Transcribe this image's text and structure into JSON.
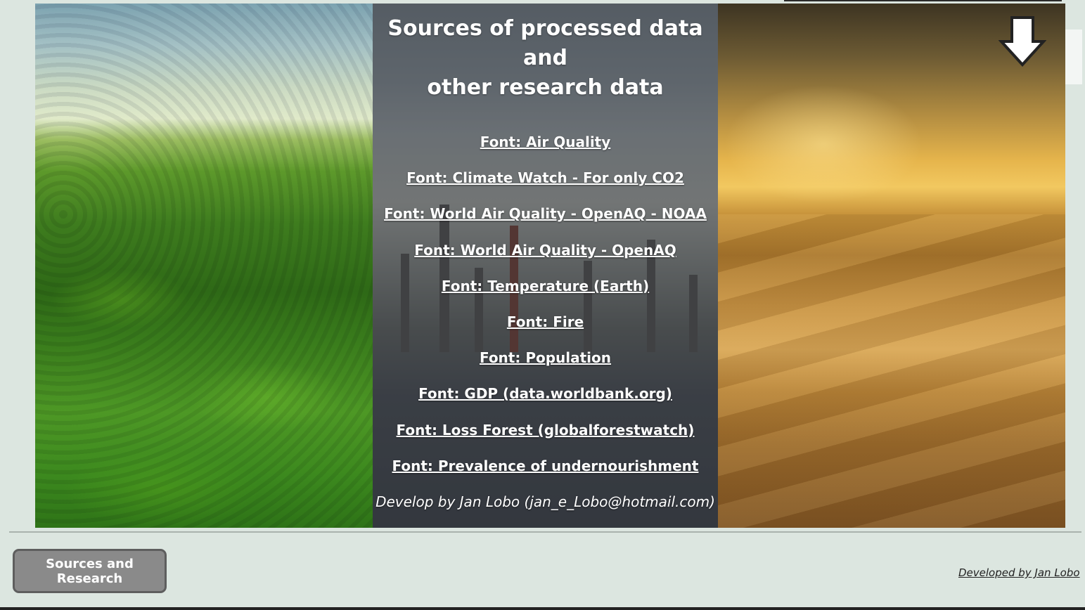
{
  "panel": {
    "title_line1": "Sources of processed data and",
    "title_line2": "other research data",
    "links": [
      "Font: Air Quality",
      "Font: Climate Watch - For only CO2",
      "Font: World Air Quality - OpenAQ - NOAA",
      "Font: World Air Quality - OpenAQ",
      "Font: Temperature (Earth)",
      "Font: Fire",
      "Font: Population",
      "Font: GDP (data.worldbank.org)",
      "Font: Loss Forest (globalforestwatch)",
      "Font: Prevalence of undernourishment"
    ],
    "credit": "Develop by Jan Lobo (jan_e_Lobo@hotmail.com)"
  },
  "nav": {
    "scroll_down_icon": "arrow-down-icon"
  },
  "footer": {
    "button_label": "Sources and Research",
    "credit_link": "Developed by Jan Lobo"
  },
  "colors": {
    "page_background": "#dce6e0",
    "button_background": "#8a8a8a",
    "button_border": "#5e5e5e",
    "link_text": "#ffffff"
  }
}
